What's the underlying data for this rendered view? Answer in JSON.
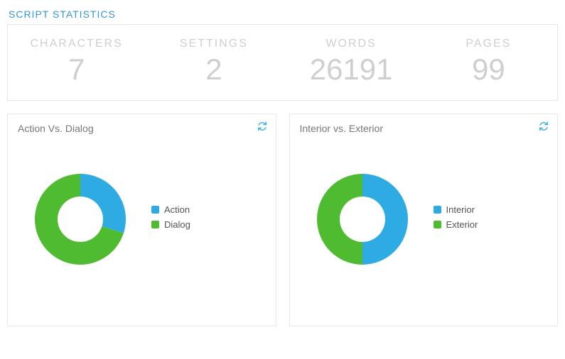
{
  "section_title": "SCRIPT STATISTICS",
  "colors": {
    "blue": "#2dabe2",
    "green": "#55bично"
  },
  "stats": [
    {
      "label": "CHARACTERS",
      "value": "7"
    },
    {
      "label": "SETTINGS",
      "value": "2"
    },
    {
      "label": "WORDS",
      "value": "26191"
    },
    {
      "label": "PAGES",
      "value": "99"
    }
  ],
  "cards": [
    {
      "title": "Action Vs. Dialog",
      "legend": [
        {
          "label": "Action",
          "color": "#2dabe2"
        },
        {
          "label": "Dialog",
          "color": "#4fbb31"
        }
      ]
    },
    {
      "title": "Interior vs. Exterior",
      "legend": [
        {
          "label": "Interior",
          "color": "#2dabe2"
        },
        {
          "label": "Exterior",
          "color": "#4fbb31"
        }
      ]
    }
  ],
  "chart_data": [
    {
      "type": "pie",
      "title": "Action Vs. Dialog",
      "series": [
        {
          "name": "Action",
          "value": 40,
          "color": "#2dabe2"
        },
        {
          "name": "Dialog",
          "value": 60,
          "color": "#4fbb31"
        }
      ]
    },
    {
      "type": "pie",
      "title": "Interior vs. Exterior",
      "series": [
        {
          "name": "Interior",
          "value": 50,
          "color": "#2dabe2"
        },
        {
          "name": "Exterior",
          "value": 50,
          "color": "#4fbb31"
        }
      ]
    }
  ]
}
